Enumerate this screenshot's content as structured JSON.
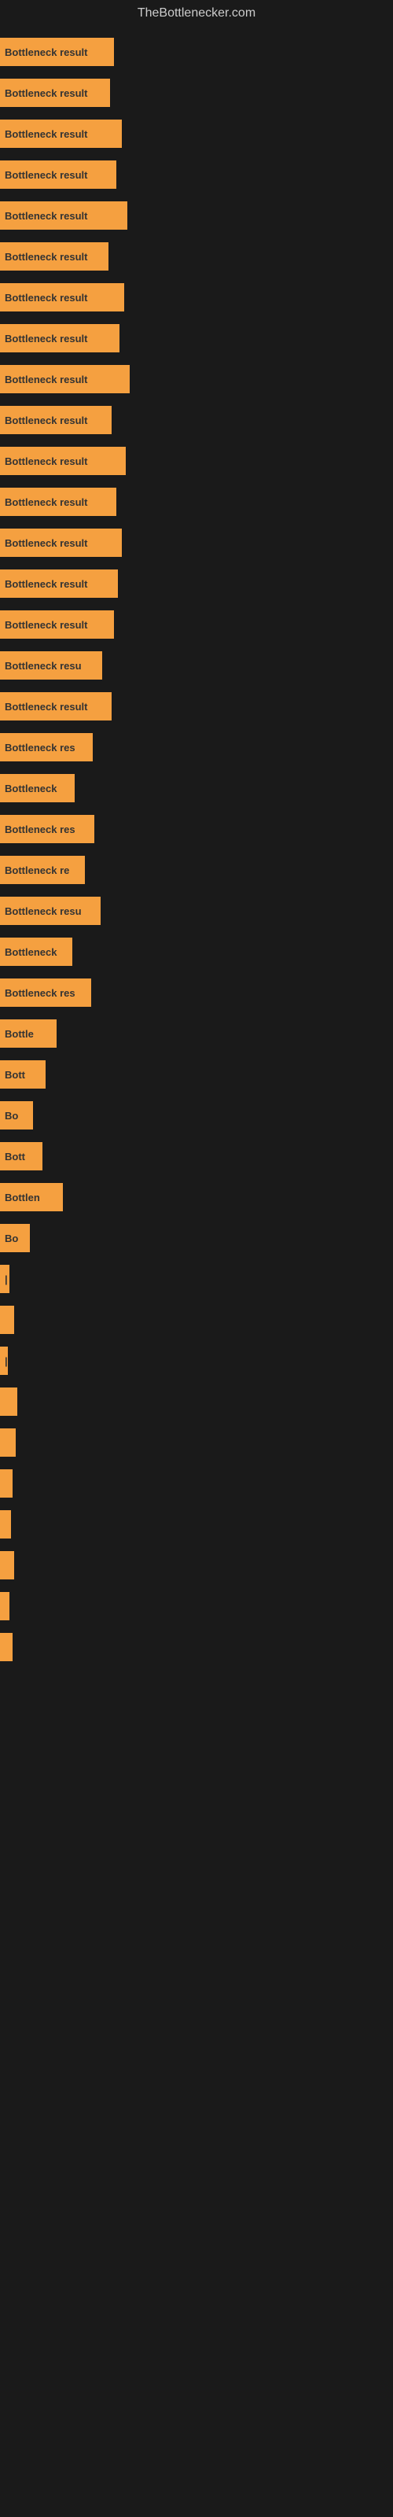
{
  "site_title": "TheBottlenecker.com",
  "bars": [
    {
      "label": "Bottleneck result",
      "width": 145
    },
    {
      "label": "Bottleneck result",
      "width": 140
    },
    {
      "label": "Bottleneck result",
      "width": 155
    },
    {
      "label": "Bottleneck result",
      "width": 148
    },
    {
      "label": "Bottleneck result",
      "width": 162
    },
    {
      "label": "Bottleneck result",
      "width": 138
    },
    {
      "label": "Bottleneck result",
      "width": 158
    },
    {
      "label": "Bottleneck result",
      "width": 152
    },
    {
      "label": "Bottleneck result",
      "width": 165
    },
    {
      "label": "Bottleneck result",
      "width": 142
    },
    {
      "label": "Bottleneck result",
      "width": 160
    },
    {
      "label": "Bottleneck result",
      "width": 148
    },
    {
      "label": "Bottleneck result",
      "width": 155
    },
    {
      "label": "Bottleneck result",
      "width": 150
    },
    {
      "label": "Bottleneck result",
      "width": 145
    },
    {
      "label": "Bottleneck resu",
      "width": 130
    },
    {
      "label": "Bottleneck result",
      "width": 142
    },
    {
      "label": "Bottleneck res",
      "width": 118
    },
    {
      "label": "Bottleneck",
      "width": 95
    },
    {
      "label": "Bottleneck res",
      "width": 120
    },
    {
      "label": "Bottleneck re",
      "width": 108
    },
    {
      "label": "Bottleneck resu",
      "width": 128
    },
    {
      "label": "Bottleneck",
      "width": 92
    },
    {
      "label": "Bottleneck res",
      "width": 116
    },
    {
      "label": "Bottle",
      "width": 72
    },
    {
      "label": "Bott",
      "width": 58
    },
    {
      "label": "Bo",
      "width": 42
    },
    {
      "label": "Bott",
      "width": 54
    },
    {
      "label": "Bottlen",
      "width": 80
    },
    {
      "label": "Bo",
      "width": 38
    },
    {
      "label": "|",
      "width": 12
    },
    {
      "label": "",
      "width": 18
    },
    {
      "label": "|",
      "width": 10
    },
    {
      "label": "",
      "width": 22
    },
    {
      "label": "",
      "width": 20
    },
    {
      "label": "",
      "width": 16
    },
    {
      "label": "",
      "width": 14
    },
    {
      "label": "",
      "width": 18
    },
    {
      "label": "",
      "width": 12
    },
    {
      "label": "",
      "width": 16
    }
  ]
}
